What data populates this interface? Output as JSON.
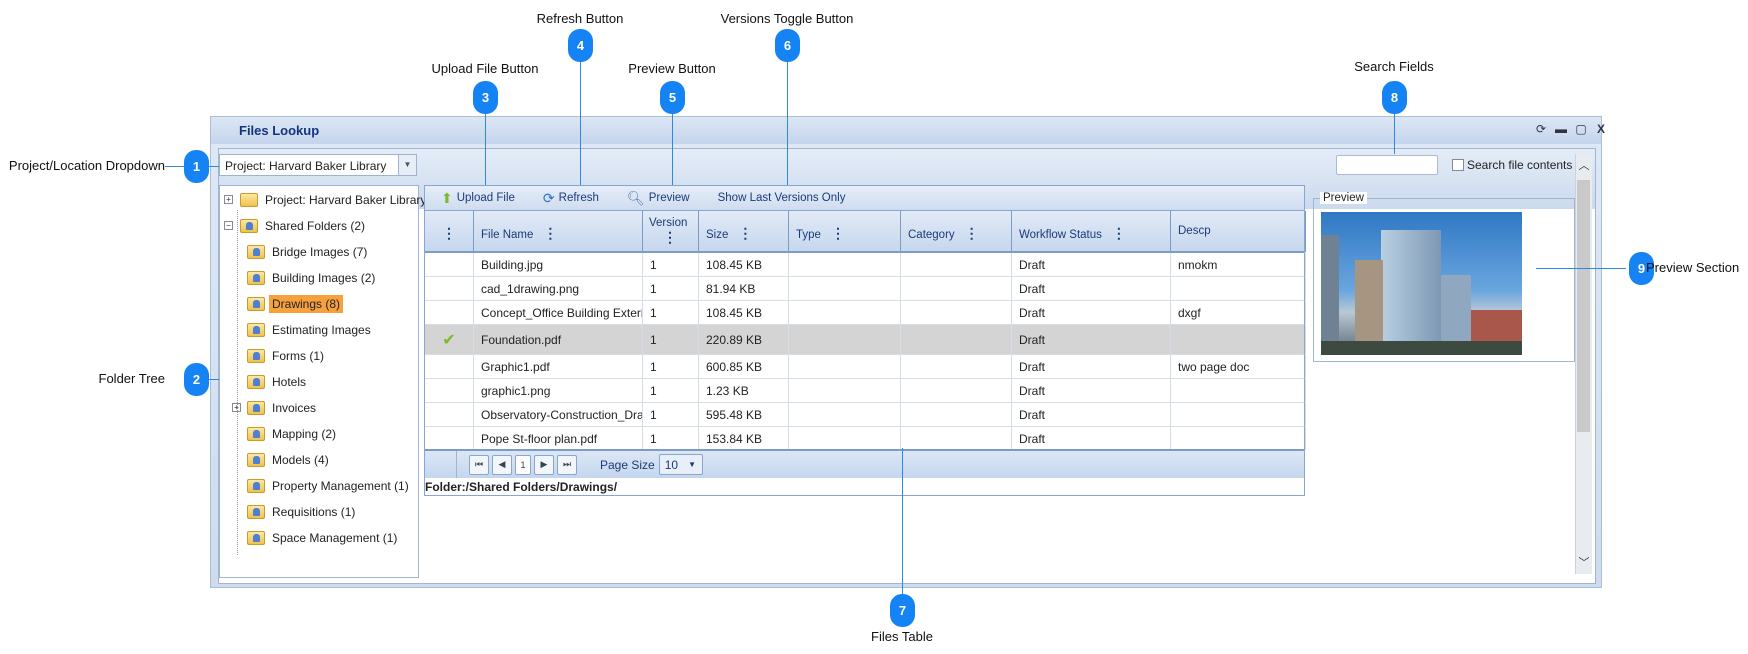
{
  "window": {
    "title": "Files Lookup"
  },
  "project_dropdown": {
    "value": "Project: Harvard Baker Library"
  },
  "search": {
    "value": "",
    "checkbox_label": "Search file contents",
    "checked": false
  },
  "tree": {
    "items": [
      {
        "label": "Project: Harvard Baker Library",
        "level": 0,
        "expander": "+",
        "shared": false
      },
      {
        "label": "Shared Folders (2)",
        "level": 0,
        "expander": "-",
        "shared": true
      },
      {
        "label": "Bridge Images (7)",
        "level": 1
      },
      {
        "label": "Building Images (2)",
        "level": 1
      },
      {
        "label": "Drawings (8)",
        "level": 1,
        "selected": true
      },
      {
        "label": "Estimating Images",
        "level": 1
      },
      {
        "label": "Forms (1)",
        "level": 1
      },
      {
        "label": "Hotels",
        "level": 1
      },
      {
        "label": "Invoices",
        "level": 1,
        "expander": "+"
      },
      {
        "label": "Mapping (2)",
        "level": 1
      },
      {
        "label": "Models (4)",
        "level": 1
      },
      {
        "label": "Property Management (1)",
        "level": 1
      },
      {
        "label": "Requisitions (1)",
        "level": 1
      },
      {
        "label": "Space Management (1)",
        "level": 1
      }
    ]
  },
  "toolbar": {
    "upload": "Upload File",
    "refresh": "Refresh",
    "preview": "Preview",
    "versions": "Show Last Versions Only"
  },
  "table": {
    "columns": [
      "",
      "File Name",
      "Version",
      "Size",
      "Type",
      "Category",
      "Workflow Status",
      "Descp"
    ],
    "rows": [
      [
        "",
        "Building.jpg",
        "1",
        "108.45 KB",
        "",
        "",
        "Draft",
        "nmokm"
      ],
      [
        "",
        "cad_1drawing.png",
        "1",
        "81.94 KB",
        "",
        "",
        "Draft",
        ""
      ],
      [
        "",
        "Concept_Office Building Exterior",
        "1",
        "108.45 KB",
        "",
        "",
        "Draft",
        "dxgf"
      ],
      [
        "check",
        "Foundation.pdf",
        "1",
        "220.89 KB",
        "",
        "",
        "Draft",
        ""
      ],
      [
        "",
        "Graphic1.pdf",
        "1",
        "600.85 KB",
        "",
        "",
        "Draft",
        "two page doc"
      ],
      [
        "",
        "graphic1.png",
        "1",
        "1.23 KB",
        "",
        "",
        "Draft",
        ""
      ],
      [
        "",
        "Observatory-Construction_Drawing",
        "1",
        "595.48 KB",
        "",
        "",
        "Draft",
        ""
      ],
      [
        "",
        "Pope St-floor plan.pdf",
        "1",
        "153.84 KB",
        "",
        "",
        "Draft",
        ""
      ]
    ],
    "selected_row": 3
  },
  "pager": {
    "page": "1",
    "page_size_label": "Page Size",
    "page_size": "10"
  },
  "folder_path": "Folder:/Shared Folders/Drawings/",
  "preview": {
    "label": "Preview"
  },
  "callouts": [
    {
      "n": "1",
      "label": "Project/Location Dropdown"
    },
    {
      "n": "2",
      "label": "Folder Tree"
    },
    {
      "n": "3",
      "label": "Upload File Button"
    },
    {
      "n": "4",
      "label": "Refresh Button"
    },
    {
      "n": "5",
      "label": "Preview Button"
    },
    {
      "n": "6",
      "label": "Versions Toggle Button"
    },
    {
      "n": "7",
      "label": "Files Table"
    },
    {
      "n": "8",
      "label": "Search Fields"
    },
    {
      "n": "9",
      "label": "Preview Section"
    }
  ],
  "colors": {
    "callout": "#1583f3",
    "selected_folder": "#f7a13e",
    "header_text": "#1b3a78"
  }
}
